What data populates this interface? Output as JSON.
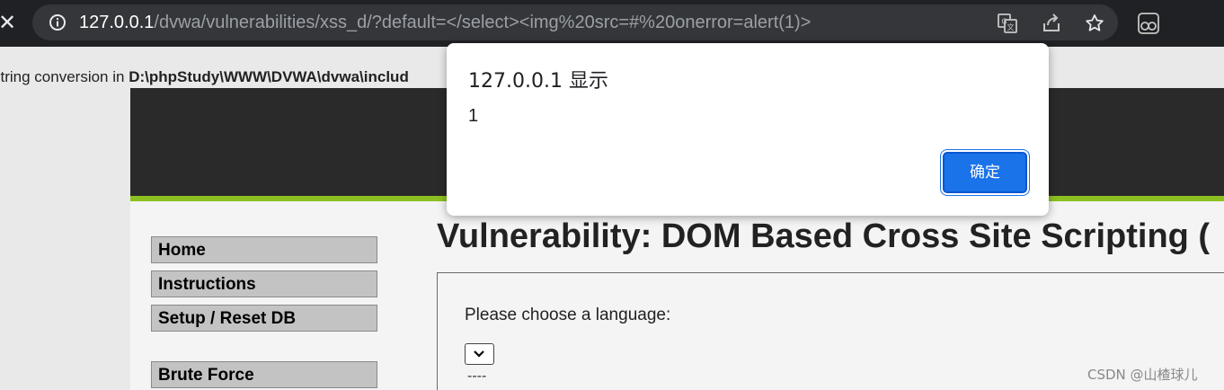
{
  "browser": {
    "url_host": "127.0.0.1",
    "url_path": "/dvwa/vulnerabilities/xss_d/?default=</select><img%20src=#%20onerror=alert(1)>",
    "icons": [
      "info-icon",
      "translate-icon",
      "share-icon",
      "bookmark-star-icon",
      "reading-mode-icon",
      "close-icon"
    ]
  },
  "page": {
    "php_warning_prefix": "string conversion in ",
    "php_warning_path": "D:\\phpStudy\\WWW\\DVWA\\dvwa\\includ",
    "menu": [
      "Home",
      "Instructions",
      "Setup / Reset DB",
      "Brute Force"
    ],
    "title": "Vulnerability: DOM Based Cross Site Scripting (",
    "prompt": "Please choose a language:",
    "dashes": "----",
    "colors": {
      "header": "#2a2a2a",
      "stripe": "#8cc020",
      "menu_bg": "#c3c3c3"
    }
  },
  "dialog": {
    "title": "127.0.0.1 显示",
    "message": "1",
    "ok_label": "确定",
    "accent": "#1a73e8"
  },
  "watermark": "CSDN @山楂球儿"
}
